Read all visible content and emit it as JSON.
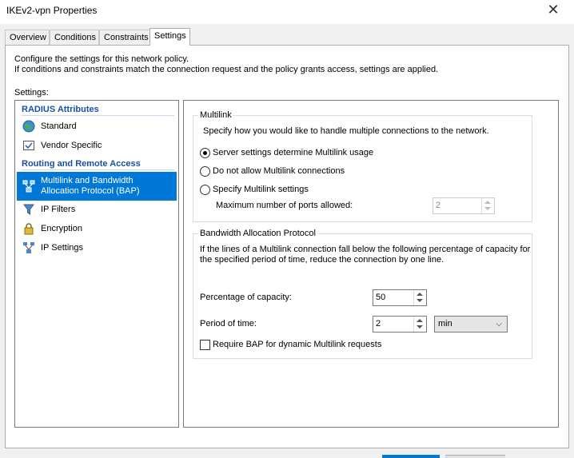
{
  "window": {
    "title": "IKEv2-vpn Properties",
    "close_glyph": "✕"
  },
  "tabs": [
    {
      "label": "Overview"
    },
    {
      "label": "Conditions"
    },
    {
      "label": "Constraints"
    },
    {
      "label": "Settings",
      "active": true
    }
  ],
  "description": {
    "line1": "Configure the settings for this network policy.",
    "line2": "If conditions and constraints match the connection request and the policy grants access, settings are applied."
  },
  "settings_label": "Settings:",
  "sidebar": {
    "categories": [
      {
        "label": "RADIUS Attributes"
      },
      {
        "label": "Routing and Remote Access"
      }
    ],
    "items": [
      {
        "label": "Standard",
        "icon": "globe-icon"
      },
      {
        "label": "Vendor Specific",
        "icon": "checkbox-icon"
      },
      {
        "label_line1": "Multilink and Bandwidth",
        "label_line2": "Allocation Protocol (BAP)",
        "icon": "network-icon",
        "selected": true
      },
      {
        "label": "IP Filters",
        "icon": "filter-icon"
      },
      {
        "label": "Encryption",
        "icon": "lock-icon"
      },
      {
        "label": "IP Settings",
        "icon": "network-icon"
      }
    ]
  },
  "multilink": {
    "title": "Multilink",
    "instruction": "Specify how you would like to handle multiple connections to the network.",
    "options": [
      {
        "label": "Server settings determine Multilink usage",
        "selected": true
      },
      {
        "label": "Do not allow Multilink connections",
        "selected": false
      },
      {
        "label": "Specify Multilink settings",
        "selected": false
      }
    ],
    "max_ports_label": "Maximum number of ports allowed:",
    "max_ports_value": "2"
  },
  "bap": {
    "title": "Bandwidth Allocation Protocol",
    "desc_line1": "If the lines of a Multilink connection fall below the following percentage of capacity for",
    "desc_line2": "the specified period of time, reduce the connection by one line.",
    "percentage_label": "Percentage of capacity:",
    "percentage_value": "50",
    "period_label": "Period of time:",
    "period_value": "2",
    "period_unit": "min",
    "require_label": "Require BAP for dynamic Multilink requests",
    "require_checked": false
  },
  "colors": {
    "selection": "#0078d7",
    "category_text": "#1a4fa3"
  }
}
